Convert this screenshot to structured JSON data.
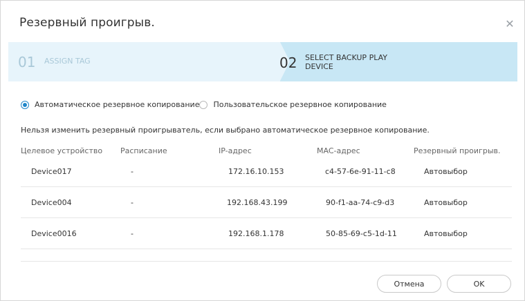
{
  "dialog": {
    "title": "Резервный проигрыв.",
    "close_icon": "close-icon"
  },
  "steps": [
    {
      "number": "01",
      "label": "ASSIGN TAG",
      "active": false
    },
    {
      "number": "02",
      "label": "SELECT BACKUP PLAY DEVICE",
      "active": true
    }
  ],
  "options": {
    "auto_label": "Автоматическое резервное копирование",
    "custom_label": "Пользовательское резервное копирование",
    "selected": "auto"
  },
  "note": "Нельзя изменить резервный проигрыватель, если выбрано автоматическое резервное копирование.",
  "table": {
    "columns": [
      "Целевое устройство",
      "Расписание",
      "IP-адрес",
      "MAC-адрес",
      "Резервный проигрыв."
    ],
    "rows": [
      {
        "device": "Device017",
        "schedule": "-",
        "ip": "172.16.10.153",
        "mac": "c4-57-6e-91-11-c8",
        "backup": "Автовыбор"
      },
      {
        "device": "Device004",
        "schedule": "-",
        "ip": "192.168.43.199",
        "mac": "90-f1-aa-74-c9-d3",
        "backup": "Автовыбор"
      },
      {
        "device": "Device0016",
        "schedule": "-",
        "ip": "192.168.1.178",
        "mac": "50-85-69-c5-1d-11",
        "backup": "Автовыбор"
      }
    ]
  },
  "buttons": {
    "cancel": "Отмена",
    "ok": "OK"
  },
  "colors": {
    "accent": "#1f86c9",
    "step_active_bg": "#c8e7f5",
    "step_inactive_bg": "#e7f4fb"
  }
}
